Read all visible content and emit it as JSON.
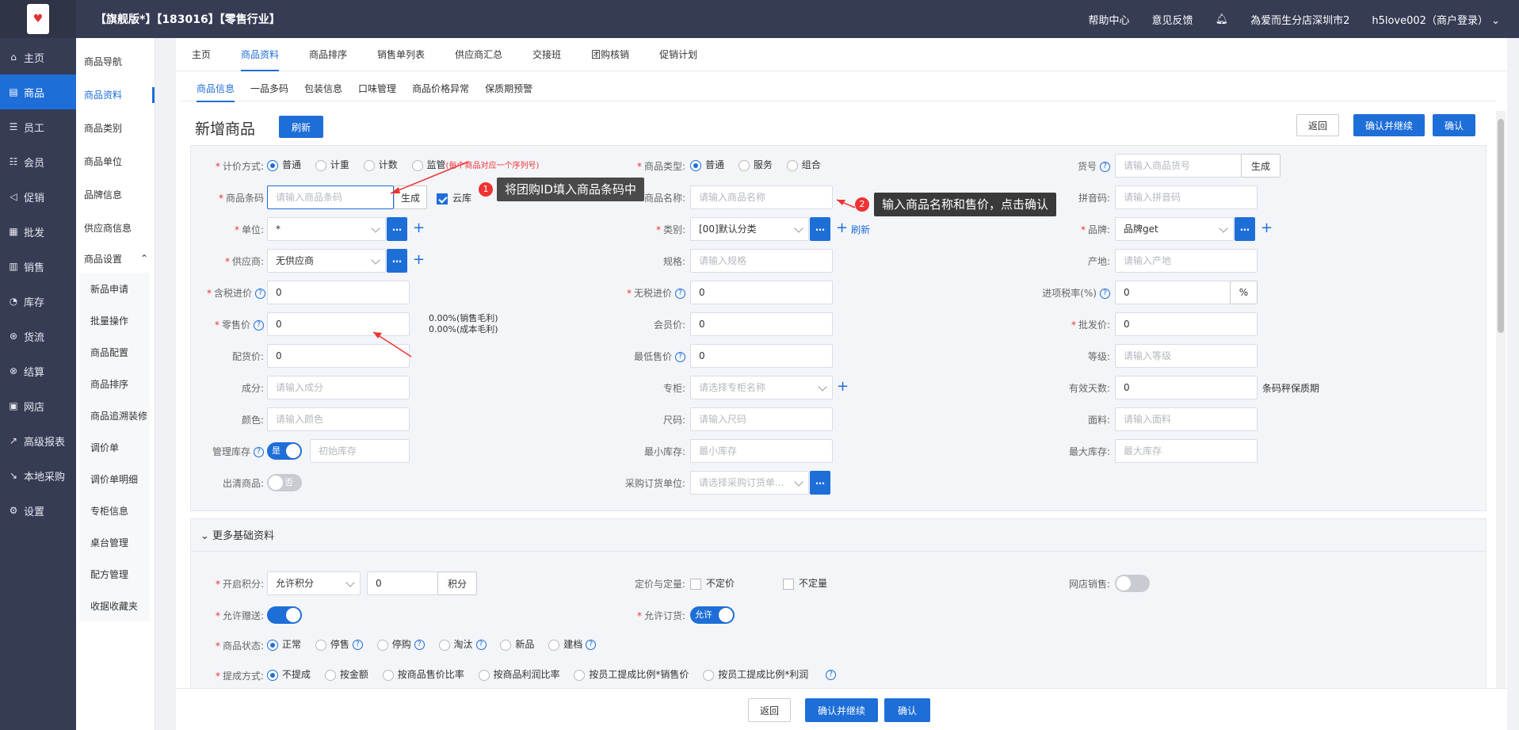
{
  "header": {
    "title": "【旗舰版*】【183016】【零售行业】",
    "help": "帮助中心",
    "feedback": "意见反馈",
    "store": "為爱而生分店深圳市2",
    "user": "h5love002（商户登录）"
  },
  "sidebar": {
    "items": [
      {
        "icon": "⌂",
        "label": "主页"
      },
      {
        "icon": "▤",
        "label": "商品"
      },
      {
        "icon": "☰",
        "label": "员工"
      },
      {
        "icon": "☷",
        "label": "会员"
      },
      {
        "icon": "◁",
        "label": "促销"
      },
      {
        "icon": "▦",
        "label": "批发"
      },
      {
        "icon": "▥",
        "label": "销售"
      },
      {
        "icon": "◔",
        "label": "库存"
      },
      {
        "icon": "⊛",
        "label": "货流"
      },
      {
        "icon": "⊗",
        "label": "结算"
      },
      {
        "icon": "▣",
        "label": "网店"
      },
      {
        "icon": "↗",
        "label": "高级报表"
      },
      {
        "icon": "↘",
        "label": "本地采购"
      },
      {
        "icon": "⚙",
        "label": "设置"
      }
    ]
  },
  "subside": {
    "items": [
      "商品导航",
      "商品资料",
      "商品类别",
      "商品单位",
      "品牌信息",
      "供应商信息"
    ],
    "group": "商品设置",
    "children": [
      "新品申请",
      "批量操作",
      "商品配置",
      "商品排序",
      "商品追溯装修",
      "调价单",
      "调价单明细",
      "专柜信息",
      "桌台管理",
      "配方管理",
      "收据收藏夹"
    ]
  },
  "tabs": [
    "主页",
    "商品资料",
    "商品排序",
    "销售单列表",
    "供应商汇总",
    "交接班",
    "团购核销",
    "促销计划"
  ],
  "subtabs": [
    "商品信息",
    "一品多码",
    "包装信息",
    "口味管理",
    "商品价格异常",
    "保质期预警"
  ],
  "page": {
    "title": "新增商品",
    "refresh": "刷新",
    "back": "返回",
    "confirm_continue": "确认并继续",
    "confirm": "确认"
  },
  "form": {
    "pricing_label": "计价方式:",
    "pricing_options": [
      "普通",
      "计重",
      "计数",
      "监管"
    ],
    "pricing_note": "(每个商品对应一个序列号)",
    "type_label": "商品类型:",
    "type_options": [
      "普通",
      "服务",
      "组合"
    ],
    "sku_label": "货号",
    "sku_ph": "请输入商品货号",
    "generate": "生成",
    "barcode_label": "商品条码",
    "barcode_ph": "请输入商品条码",
    "cloud": "云库",
    "name_label": "商品名称:",
    "name_ph": "请输入商品名称",
    "pinyin_label": "拼音码:",
    "pinyin_ph": "请输入拼音码",
    "unit_label": "单位:",
    "unit_value": "*",
    "category_label": "类别:",
    "category_value": "[00]默认分类",
    "refresh_link": "刷新",
    "brand_label": "品牌:",
    "brand_value": "品牌get",
    "supplier_label": "供应商:",
    "supplier_value": "无供应商",
    "spec_label": "规格:",
    "spec_ph": "请输入规格",
    "origin_label": "产地:",
    "origin_ph": "请输入产地",
    "taxin_label": "含税进价",
    "taxin_value": "0",
    "notax_label": "无税进价",
    "notax_value": "0",
    "taxrate_label": "进项税率(%)",
    "taxrate_value": "0",
    "percent": "%",
    "retail_label": "零售价",
    "retail_value": "0",
    "margin1": "0.00%(销售毛利)",
    "margin2": "0.00%(成本毛利)",
    "member_label": "会员价:",
    "member_value": "0",
    "wholesale_label": "批发价:",
    "wholesale_value": "0",
    "dist_label": "配货价:",
    "dist_value": "0",
    "min_price_label": "最低售价",
    "min_price_value": "0",
    "grade_label": "等级:",
    "grade_ph": "请输入等级",
    "comp_label": "成分:",
    "comp_ph": "请输入成分",
    "counter_label": "专柜:",
    "counter_ph": "请选择专柜名称",
    "valid_label": "有效天数:",
    "valid_value": "0",
    "valid_note": "条码秤保质期",
    "color_label": "颜色:",
    "color_ph": "请输入颜色",
    "size_label": "尺码:",
    "size_ph": "请输入尺码",
    "fabric_label": "面料:",
    "fabric_ph": "请输入面料",
    "stock_label": "管理库存",
    "stock_toggle": "是",
    "init_stock_ph": "初始库存",
    "minstock_label": "最小库存:",
    "minstock_ph": "最小库存",
    "maxstock_label": "最大库存:",
    "maxstock_ph": "最大库存",
    "clear_label": "出清商品:",
    "clear_toggle": "否",
    "purchase_unit_label": "采购订货单位:",
    "purchase_unit_ph": "请选择采购订货单..."
  },
  "annotations": {
    "tip1": "将团购ID填入商品条码中",
    "tip2": "输入商品名称和售价，点击确认",
    "n1": "1",
    "n2": "2"
  },
  "more": {
    "title": "更多基础资料",
    "points_label": "开启积分:",
    "points_select": "允许积分",
    "points_value": "0",
    "points_unit": "积分",
    "fixed_label": "定价与定量:",
    "fixed_price": "不定价",
    "fixed_qty": "不定量",
    "online_label": "网店销售:",
    "gift_label": "允许赠送:",
    "order_label": "允许订货:",
    "order_toggle": "允许",
    "status_label": "商品状态:",
    "status_options": [
      "正常",
      "停售",
      "停购",
      "淘汰",
      "新品",
      "建档"
    ],
    "commission_label": "提成方式:",
    "commission_options": [
      "不提成",
      "按金额",
      "按商品售价比率",
      "按商品利润比率",
      "按员工提成比例*销售价",
      "按员工提成比例*利润"
    ]
  },
  "colors": {
    "accent": "#1e6ed8",
    "sidebar": "#363c54",
    "required": "#e33333"
  }
}
